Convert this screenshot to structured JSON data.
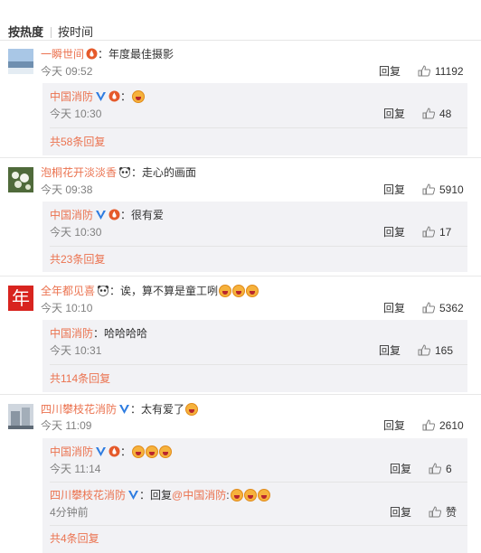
{
  "tabs": [
    "按热度",
    "按时间"
  ],
  "reply_label": "回复",
  "colors": {
    "name": "#eb7350",
    "badge_v": "#2e7ce0",
    "badge_fire": "#e55a2b",
    "reply_bg": "#f2f2f5"
  },
  "comments": [
    {
      "author": "一瞬世间",
      "text": "：年度最佳摄影",
      "time": "今天 09:52",
      "likes": "11192",
      "reply": {
        "author": "中国消防",
        "text": "：",
        "time": "今天 10:30",
        "likes": "48"
      },
      "more": "共58条回复"
    },
    {
      "author": "泡桐花开淡淡香",
      "text": "：走心的画面",
      "time": "今天 09:38",
      "likes": "5910",
      "reply": {
        "author": "中国消防",
        "text": "：很有爱",
        "time": "今天 10:30",
        "likes": "17"
      },
      "more": "共23条回复"
    },
    {
      "author": "全年都见喜",
      "text": "：诶，算不算是童工咧",
      "time": "今天 10:10",
      "likes": "5362",
      "avatar_text": "年",
      "reply": {
        "author": "中国消防",
        "text": "：哈哈哈哈",
        "time": "今天 10:31",
        "likes": "165"
      },
      "more": "共114条回复"
    },
    {
      "author": "四川攀枝花消防",
      "text": "：太有爱了",
      "time": "今天 11:09",
      "likes": "2610",
      "reply": {
        "author": "中国消防",
        "text": "：",
        "time": "今天 11:14",
        "likes": "6"
      },
      "reply2": {
        "author": "四川攀枝花消防",
        "text": "：回复",
        "mention": "@中国消防",
        "tail": ":",
        "time": "4分钟前",
        "likes": "赞"
      },
      "more": "共4条回复"
    }
  ]
}
